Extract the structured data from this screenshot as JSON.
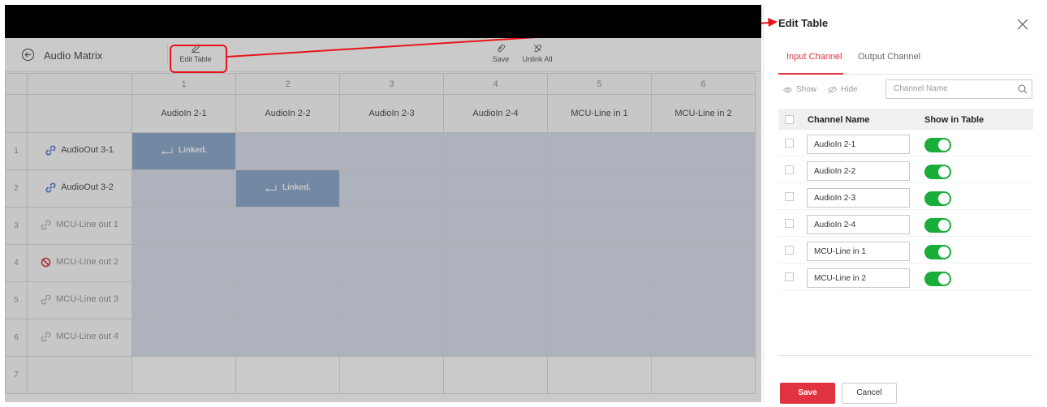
{
  "app": {
    "title": "Audio Matrix",
    "toolbar": {
      "edit_table": "Edit Table",
      "save": "Save",
      "unlink_all": "Unlink All"
    },
    "column_numbers": [
      "1",
      "2",
      "3",
      "4",
      "5",
      "6"
    ],
    "column_names": [
      "AudioIn 2-1",
      "AudioIn 2-2",
      "AudioIn 2-3",
      "AudioIn 2-4",
      "MCU-Line in 1",
      "MCU-Line in 2"
    ],
    "rows": [
      {
        "num": "1",
        "label": "AudioOut 3-1",
        "icon": "link-icon",
        "linked_col": 1
      },
      {
        "num": "2",
        "label": "AudioOut 3-2",
        "icon": "link-icon",
        "linked_col": 2
      },
      {
        "num": "3",
        "label": "MCU-Line out 1",
        "icon": "link-icon-disabled",
        "linked_col": null
      },
      {
        "num": "4",
        "label": "MCU-Line out 2",
        "icon": "prohibited-icon",
        "linked_col": null
      },
      {
        "num": "5",
        "label": "MCU-Line out 3",
        "icon": "link-icon-disabled",
        "linked_col": null
      },
      {
        "num": "6",
        "label": "MCU-Line out 4",
        "icon": "link-icon-disabled",
        "linked_col": null
      },
      {
        "num": "7",
        "label": "",
        "icon": "",
        "linked_col": null
      }
    ],
    "linked_text": "Linked."
  },
  "panel": {
    "title": "Edit Table",
    "tabs": [
      "Input Channel",
      "Output Channel"
    ],
    "show": "Show",
    "hide": "Hide",
    "search_placeholder": "Channel Name",
    "col_name": "Channel Name",
    "col_show": "Show in Table",
    "channels": [
      {
        "name": "AudioIn 2-1",
        "show": true
      },
      {
        "name": "AudioIn 2-2",
        "show": true
      },
      {
        "name": "AudioIn 2-3",
        "show": true
      },
      {
        "name": "AudioIn 2-4",
        "show": true
      },
      {
        "name": "MCU-Line in 1",
        "show": true
      },
      {
        "name": "MCU-Line in 2",
        "show": true
      }
    ],
    "save": "Save",
    "cancel": "Cancel"
  },
  "colors": {
    "accent_red": "#e0333f",
    "toggle_green": "#19ad3a",
    "linked_blue": "#7f9fc6",
    "link_icon_blue": "#3b6fd4"
  }
}
